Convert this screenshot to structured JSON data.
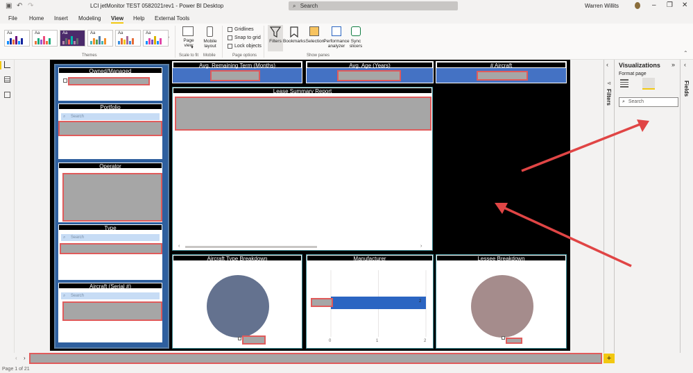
{
  "window": {
    "title": "LCI jetMonitor TEST 0582021rev1 - Power BI Desktop",
    "search_placeholder": "Search",
    "user": "Warren Willits"
  },
  "menu": [
    "File",
    "Home",
    "Insert",
    "Modeling",
    "View",
    "Help",
    "External Tools"
  ],
  "menu_active": "View",
  "ribbon": {
    "themes_label": "Themes",
    "page_view_label": "Page view",
    "page_view_dropdown": "▾",
    "mobile_layout_label": "Mobile layout",
    "scale_to_fit_label": "Scale to fit",
    "mobile_group_label": "Mobile",
    "gridlines_label": "Gridlines",
    "snap_to_grid_label": "Snap to grid",
    "lock_objects_label": "Lock objects",
    "page_options_label": "Page options",
    "filters_label": "Filters",
    "bookmarks_label": "Bookmarks",
    "selection_label": "Selection",
    "performance_analyzer_label": "Performance analyzer",
    "sync_slicers_label": "Sync slicers",
    "show_panes_label": "Show panes"
  },
  "slicers": {
    "owned_managed": "Owned/Managed",
    "portfolio": "Portfolio",
    "operator": "Operator",
    "type": "Type",
    "aircraft_serial": "Aircraft (Serial #)",
    "search_placeholder": "Search"
  },
  "kpis": {
    "avg_remaining_term": "Avg. Remaining Term (Months)",
    "avg_age": "Avg. Age (Years)",
    "aircraft_count": "# Aircraft"
  },
  "report": {
    "lease_summary_title": "Lease Summary Report"
  },
  "charts": {
    "aircraft_type_title": "Aircraft Type Breakdown",
    "manufacturer_title": "Manufacturer",
    "lessee_title": "Lessee Breakdown",
    "manufacturer_bar_value": "2",
    "manufacturer_ticks": [
      "0",
      "1",
      "2"
    ]
  },
  "chart_data": [
    {
      "type": "pie",
      "title": "Aircraft Type Breakdown",
      "values": [
        1
      ],
      "colors": [
        "#64728f"
      ]
    },
    {
      "type": "bar",
      "title": "Manufacturer",
      "orientation": "horizontal",
      "values": [
        2
      ],
      "xlim": [
        0,
        2
      ],
      "x_ticks": [
        0,
        1,
        2
      ],
      "data_labels": [
        "2"
      ],
      "colors": [
        "#2b65c2"
      ]
    },
    {
      "type": "pie",
      "title": "Lessee Breakdown",
      "values": [
        1
      ],
      "colors": [
        "#a58c8c"
      ]
    }
  ],
  "panes": {
    "filters_label": "Filters",
    "visualizations_title": "Visualizations",
    "format_page_label": "Format page",
    "search_placeholder": "Search",
    "fields_label": "Fields"
  },
  "bottom": {
    "add_page": "+",
    "status": "Page 1 of 21"
  },
  "colors": {
    "accent_yellow": "#f2c811",
    "redaction_border": "#e05b5b",
    "annotation_arrow": "#e04545",
    "kpi_fill": "#4472c4",
    "slicer_panel": "#2e5f9e"
  },
  "icons": {
    "save": "save-icon",
    "undo": "undo-icon",
    "redo": "redo-icon",
    "search": "search-icon",
    "report_view": "report-view-icon",
    "data_view": "data-view-icon",
    "model_view": "model-view-icon"
  }
}
